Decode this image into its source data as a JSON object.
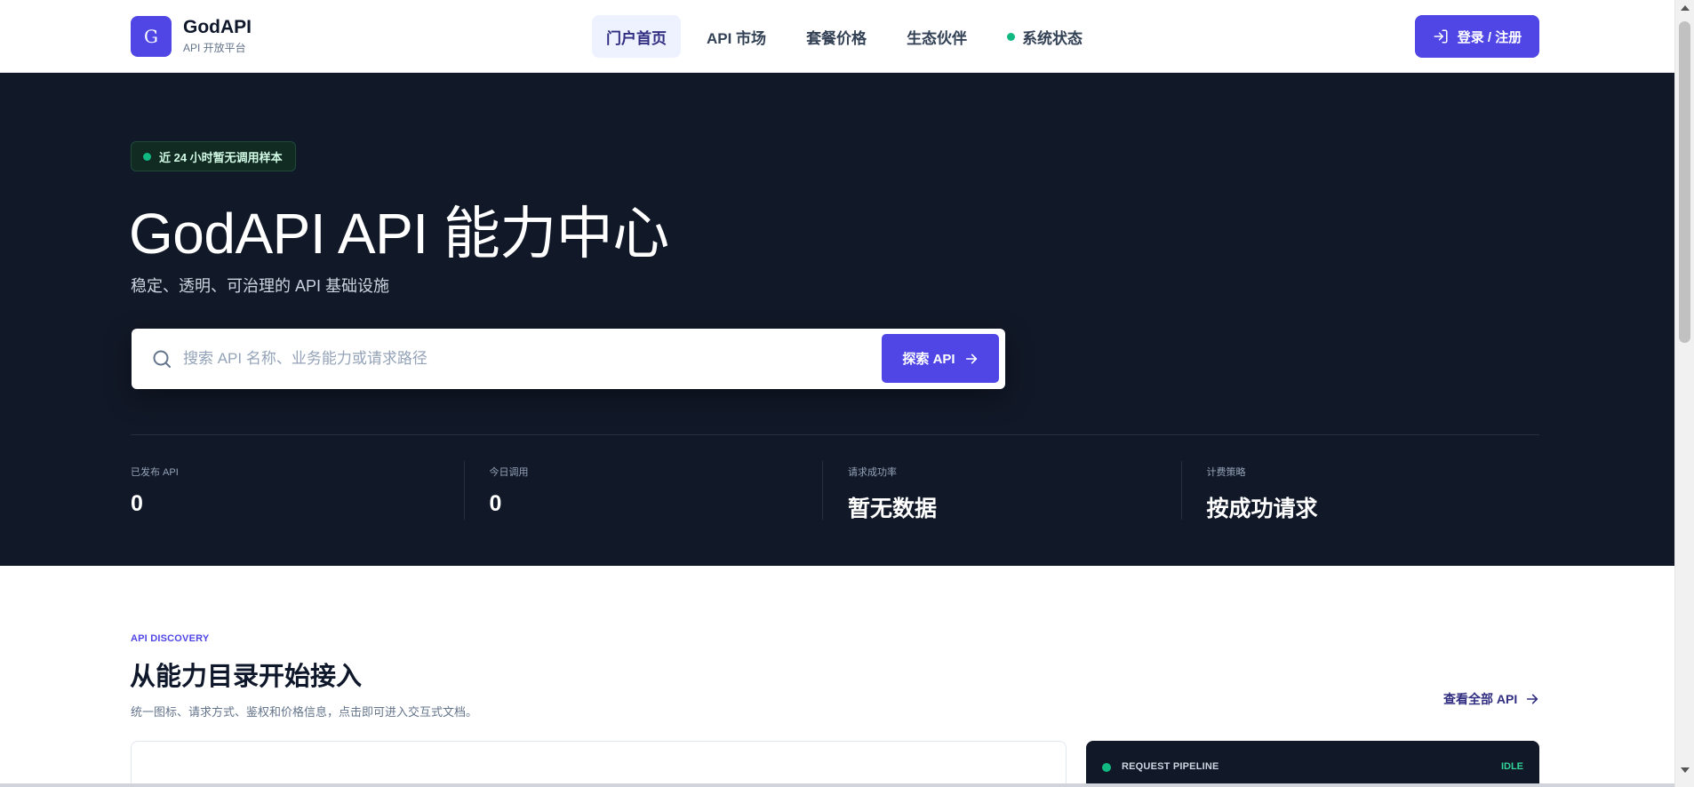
{
  "brand": {
    "logo_letter": "G",
    "name": "GodAPI",
    "subtitle": "API 开放平台"
  },
  "nav": {
    "items": [
      {
        "label": "门户首页",
        "active": true
      },
      {
        "label": "API 市场",
        "active": false
      },
      {
        "label": "套餐价格",
        "active": false
      },
      {
        "label": "生态伙伴",
        "active": false
      },
      {
        "label": "系统状态",
        "active": false,
        "status_dot_color": "#10b981"
      }
    ]
  },
  "header": {
    "login_label": "登录 / 注册",
    "login_icon": "login-icon"
  },
  "hero": {
    "badge": "近 24 小时暂无调用样本",
    "title": "GodAPI API 能力中心",
    "subtitle": "稳定、透明、可治理的 API 基础设施",
    "search": {
      "placeholder": "搜索 API 名称、业务能力或请求路径",
      "value": "",
      "button_label": "探索 API"
    },
    "stats": [
      {
        "label": "已发布 API",
        "value": "0"
      },
      {
        "label": "今日调用",
        "value": "0"
      },
      {
        "label": "请求成功率",
        "value": "暂无数据"
      },
      {
        "label": "计费策略",
        "value": "按成功请求"
      }
    ]
  },
  "discovery": {
    "eyebrow": "API DISCOVERY",
    "title": "从能力目录开始接入",
    "subtitle": "统一图标、请求方式、鉴权和价格信息，点击即可进入交互式文档。",
    "view_all": "查看全部 API"
  },
  "pipeline": {
    "label": "REQUEST PIPELINE",
    "state": "IDLE"
  },
  "colors": {
    "accent": "#4f46e5",
    "hero_bg": "#111827",
    "success": "#10b981"
  }
}
